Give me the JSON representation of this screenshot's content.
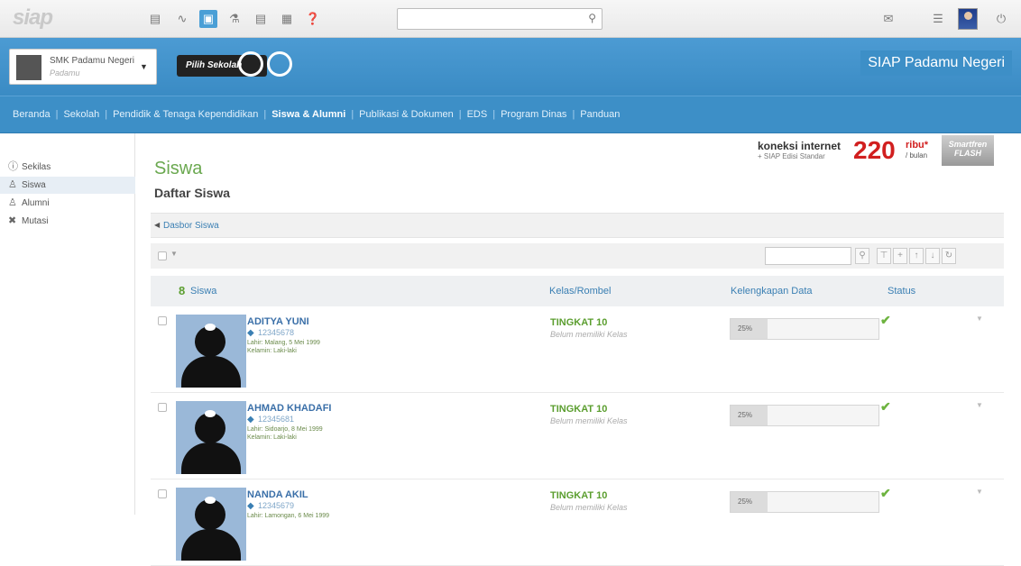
{
  "app": {
    "logo": "siap"
  },
  "topbar": {
    "icons": [
      "cube-icon",
      "rss-icon",
      "sitemap-icon",
      "people-icon",
      "document-icon",
      "id-card-icon",
      "help-icon"
    ],
    "search_placeholder": "",
    "right_icons": [
      "mail-icon",
      "list-icon",
      "user-avatar",
      "power-icon"
    ]
  },
  "school": {
    "name": "SMK Padamu Negeri",
    "sub": "Padamu",
    "pilih_label": "Pilih Sekolah",
    "brand_title": "SIAP Padamu Negeri"
  },
  "nav": {
    "items": [
      {
        "label": "Beranda",
        "active": false
      },
      {
        "label": "Sekolah",
        "active": false
      },
      {
        "label": "Pendidik & Tenaga Kependidikan",
        "active": false
      },
      {
        "label": "Siswa & Alumni",
        "active": true
      },
      {
        "label": "Publikasi & Dokumen",
        "active": false
      },
      {
        "label": "EDS",
        "active": false
      },
      {
        "label": "Program Dinas",
        "active": false
      },
      {
        "label": "Panduan",
        "active": false
      }
    ]
  },
  "sidebar": {
    "items": [
      {
        "label": "Sekilas",
        "icon": "info-icon",
        "active": false
      },
      {
        "label": "Siswa",
        "icon": "student-icon",
        "active": true
      },
      {
        "label": "Alumni",
        "icon": "alumni-icon",
        "active": false
      },
      {
        "label": "Mutasi",
        "icon": "transfer-icon",
        "active": false
      }
    ]
  },
  "ad": {
    "line1": "koneksi internet",
    "line2": "+ SIAP Edisi Standar",
    "price": "220",
    "unit": "ribu*",
    "per": "/ bulan",
    "brand": "Smartfren FLASH"
  },
  "page": {
    "title": "Siswa",
    "subtitle": "Daftar Siswa",
    "breadcrumb": "Dasbor Siswa"
  },
  "table": {
    "count": "8",
    "count_label": "Siswa",
    "headers": {
      "kelas": "Kelas/Rombel",
      "kelengkapan": "Kelengkapan Data",
      "status": "Status"
    },
    "rows": [
      {
        "name": "ADITYA YUNI",
        "id": "12345678",
        "lahir": "Lahir: Malang, 5 Mei 1999",
        "kelamin": "Kelamin: Laki-laki",
        "tingkat": "TINGKAT 10",
        "kelas": "Belum memiliki Kelas",
        "progress_label": "25%",
        "progress": 0.25
      },
      {
        "name": "AHMAD KHADAFI",
        "id": "12345681",
        "lahir": "Lahir: Sidoarjo, 8 Mei 1999",
        "kelamin": "Kelamin: Laki-laki",
        "tingkat": "TINGKAT 10",
        "kelas": "Belum memiliki Kelas",
        "progress_label": "25%",
        "progress": 0.25
      },
      {
        "name": "NANDA AKIL",
        "id": "12345679",
        "lahir": "Lahir: Lamongan, 6 Mei 1999",
        "kelamin": "",
        "tingkat": "TINGKAT 10",
        "kelas": "Belum memiliki Kelas",
        "progress_label": "25%",
        "progress": 0.25
      }
    ]
  },
  "colors": {
    "primary_blue": "#3d8fc7",
    "green": "#5b9e2f"
  }
}
